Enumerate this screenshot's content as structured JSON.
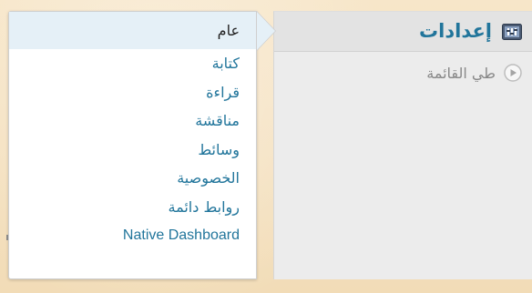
{
  "menu": {
    "title": "إعدادات",
    "icon": "settings-icon",
    "collapse_label": "طي القائمة",
    "collapse_icon": "play-circle-icon"
  },
  "submenu": {
    "items": [
      {
        "label": "عام",
        "current": true
      },
      {
        "label": "كتابة",
        "current": false
      },
      {
        "label": "قراءة",
        "current": false
      },
      {
        "label": "مناقشة",
        "current": false
      },
      {
        "label": "وسائط",
        "current": false
      },
      {
        "label": "الخصوصية",
        "current": false
      },
      {
        "label": "روابط دائمة",
        "current": false
      },
      {
        "label": "Native Dashboard",
        "current": false
      }
    ]
  },
  "colors": {
    "link": "#21759b",
    "current_bg": "#e5f0f7",
    "menu_bg": "#ececec",
    "page_bg": "#f3dfbd"
  }
}
